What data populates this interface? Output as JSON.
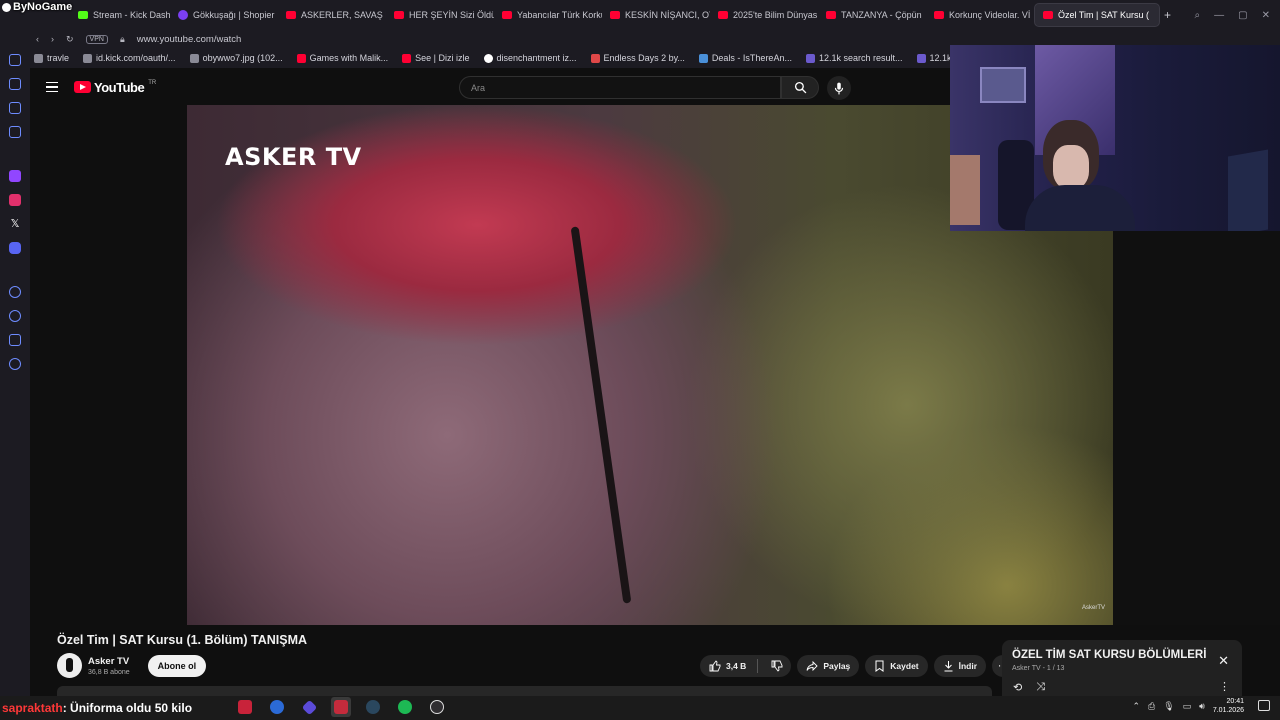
{
  "overlay": {
    "streamer_name": "ByNoGame"
  },
  "browser": {
    "tabs": [
      {
        "label": "Stream - Kick Dashbo",
        "favicon": "kick-icon"
      },
      {
        "label": "Gökkuşağı | Shopier",
        "favicon": "shopier-icon"
      },
      {
        "label": "ASKERLER, SAVAŞ Fİ",
        "favicon": "youtube-icon"
      },
      {
        "label": "HER ŞEYİN Sizi Öldü",
        "favicon": "youtube-icon"
      },
      {
        "label": "Yabancılar Türk Korku",
        "favicon": "youtube-icon"
      },
      {
        "label": "KESKİN NİŞANCI, OY",
        "favicon": "youtube-icon"
      },
      {
        "label": "2025'te Bilim Dünyası",
        "favicon": "youtube-icon"
      },
      {
        "label": "TANZANYA - Çöpün",
        "favicon": "youtube-icon"
      },
      {
        "label": "Korkunç Videolar. Vİ",
        "favicon": "youtube-icon"
      },
      {
        "label": "Özel Tim | SAT Kursu (",
        "favicon": "youtube-icon",
        "active": true
      }
    ],
    "new_tab": "+",
    "vpn_label": "VPN",
    "url": "www.youtube.com/watch",
    "ai_label": "AI",
    "bookmarks": [
      "travle",
      "id.kick.com/oauth/...",
      "obywwo7.jpg (102...",
      "Games with Malik...",
      "See | Dizi izle",
      "disenchantment iz...",
      "Endless Days 2 by...",
      "Deals - IsThereAn...",
      "12.1k search result...",
      "12.1k search res"
    ]
  },
  "youtube": {
    "logo_text": "YouTube",
    "region": "TR",
    "search_placeholder": "Ara",
    "video_logo": "ASKER TV",
    "video_watermark": "AskerTV",
    "video_title": "Özel Tim | SAT Kursu (1. Bölüm) TANIŞMA",
    "channel_name": "Asker TV",
    "subscribers": "36,8 B abone",
    "subscribe_label": "Abone ol",
    "likes": "3,4 B",
    "share_label": "Paylaş",
    "save_label": "Kaydet",
    "download_label": "İndir",
    "playlist": {
      "title": "ÖZEL TİM SAT KURSU BÖLÜMLERİ",
      "subtitle": "Asker TV - 1 / 13"
    }
  },
  "chat_overlay": {
    "user": "sapraktath",
    "message": ": Üniforma oldu 50 kilo"
  },
  "taskbar": {
    "time": "20:41",
    "date": "7.01.2026"
  },
  "colors": {
    "youtube_red": "#ff0033",
    "chat_user": "#ff3838",
    "background": "#0f0f0f"
  }
}
